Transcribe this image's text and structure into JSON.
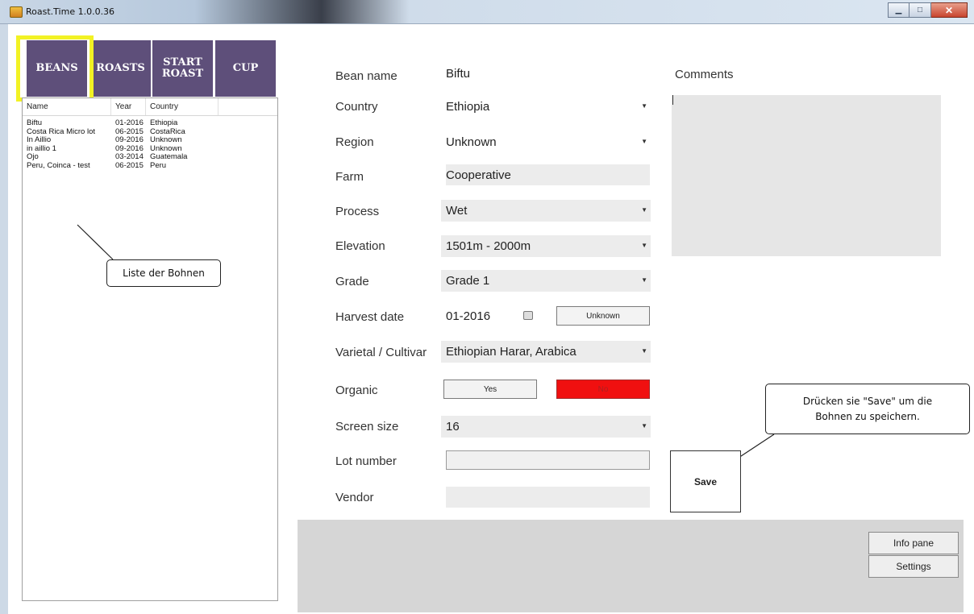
{
  "window": {
    "title": "Roast.Time 1.0.0.36"
  },
  "nav": [
    {
      "label": "BEANS"
    },
    {
      "label": "ROASTS"
    },
    {
      "label": "START\nROAST"
    },
    {
      "label": "CUP"
    }
  ],
  "beans_list": {
    "columns": [
      "Name",
      "Year",
      "Country"
    ],
    "rows": [
      {
        "name": "Biftu",
        "year": "01-2016",
        "country": "Ethiopia"
      },
      {
        "name": "Costa Rica Micro lot",
        "year": "06-2015",
        "country": "CostaRica"
      },
      {
        "name": "In Aillio",
        "year": "09-2016",
        "country": "Unknown"
      },
      {
        "name": "in aillio 1",
        "year": "09-2016",
        "country": "Unknown"
      },
      {
        "name": "Ojo",
        "year": "03-2014",
        "country": "Guatemala"
      },
      {
        "name": "Peru, Coinca - test",
        "year": "06-2015",
        "country": "Peru"
      }
    ]
  },
  "annotations": {
    "list_callout": "Liste der Bohnen",
    "save_callout": "Drücken sie \"Save\" um die Bohnen zu speichern."
  },
  "form": {
    "bean_name_label": "Bean name",
    "bean_name_value": "Biftu",
    "country_label": "Country",
    "country_value": "Ethiopia",
    "region_label": "Region",
    "region_value": "Unknown",
    "farm_label": "Farm",
    "farm_value": "Cooperative",
    "process_label": "Process",
    "process_value": "Wet",
    "elevation_label": "Elevation",
    "elevation_value": "1501m - 2000m",
    "grade_label": "Grade",
    "grade_value": "Grade 1",
    "harvest_label": "Harvest date",
    "harvest_value": "01-2016",
    "harvest_unknown_button": "Unknown",
    "varietal_label": "Varietal / Cultivar",
    "varietal_value": "Ethiopian Harar, Arabica",
    "organic_label": "Organic",
    "organic_yes": "Yes",
    "organic_no": "No",
    "screen_label": "Screen size",
    "screen_value": "16",
    "lot_label": "Lot number",
    "lot_value": "",
    "vendor_label": "Vendor",
    "vendor_value": ""
  },
  "comments": {
    "label": "Comments",
    "value": ""
  },
  "buttons": {
    "save": "Save",
    "info_pane": "Info pane",
    "settings": "Settings"
  },
  "colors": {
    "nav": "#5e4f7a",
    "highlight": "#f2f224",
    "organic_no_active": "#f01010"
  }
}
